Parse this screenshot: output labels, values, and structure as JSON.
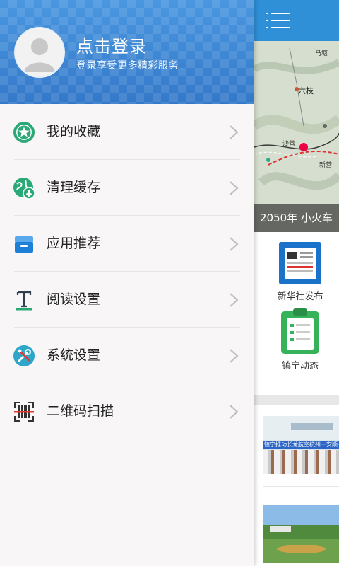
{
  "drawer": {
    "login_title": "点击登录",
    "login_subtitle": "登录享受更多精彩服务",
    "items": [
      {
        "label": "我的收藏",
        "icon": "star-icon"
      },
      {
        "label": "清理缓存",
        "icon": "globe-download-icon"
      },
      {
        "label": "应用推荐",
        "icon": "inbox-tray-icon"
      },
      {
        "label": "阅读设置",
        "icon": "text-format-icon"
      },
      {
        "label": "系统设置",
        "icon": "tools-icon"
      },
      {
        "label": "二维码扫描",
        "icon": "qr-scan-icon"
      }
    ]
  },
  "main": {
    "banner_caption": "2050年   小火车",
    "map_labels": [
      "马塘",
      "六枝",
      "沙营",
      "新营"
    ],
    "quick_items": [
      {
        "label": "新华社发布",
        "icon": "newspaper-icon"
      },
      {
        "label": "镇宁动态",
        "icon": "clipboard-icon"
      }
    ],
    "news_banner_text": "镇宁推动长龙航空杭州一安顺一镇江航线"
  },
  "colors": {
    "header_blue": "#3f86d6",
    "topbar_blue": "#2f8fd7",
    "accent_green": "#2aa876"
  }
}
